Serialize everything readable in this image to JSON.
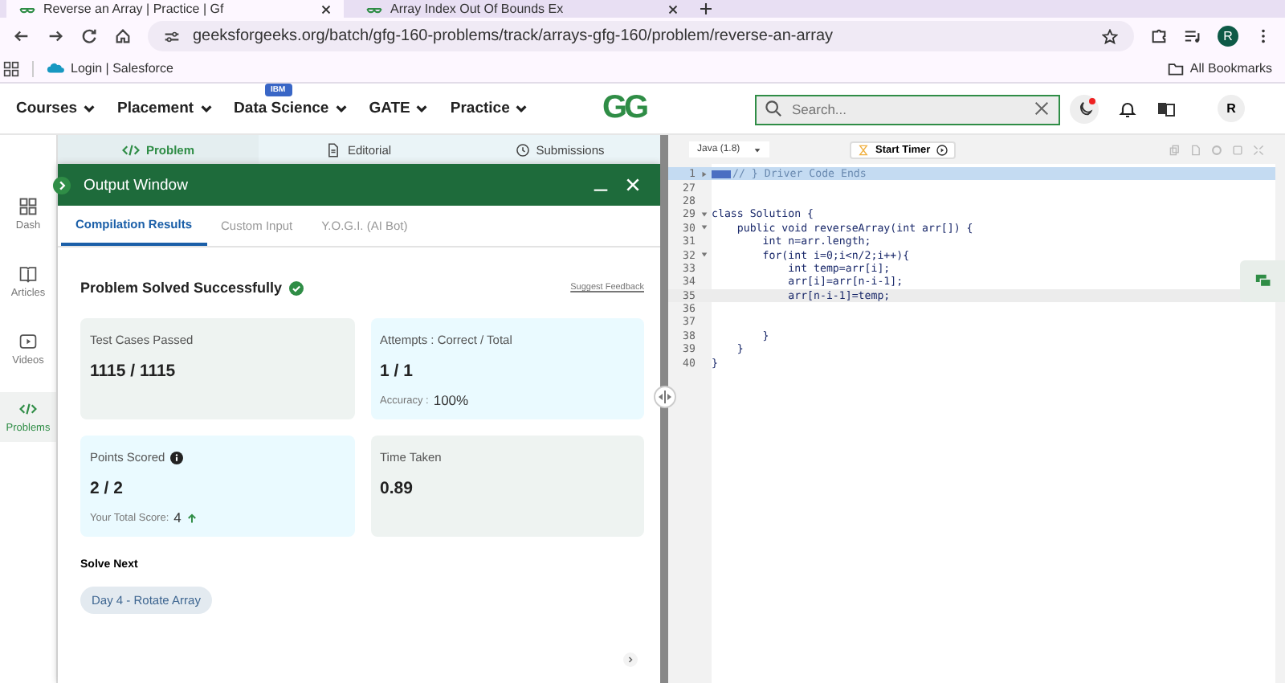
{
  "browser": {
    "tabs": [
      {
        "title": "Reverse an Array | Practice | Gf",
        "selected": true
      },
      {
        "title": "Array Index Out Of Bounds Ex",
        "selected": false
      }
    ],
    "url": "geeksforgeeks.org/batch/gfg-160-problems/track/arrays-gfg-160/problem/reverse-an-array",
    "profile": "R",
    "bookmarks": [
      "Login | Salesforce"
    ],
    "all_bookmarks": "All Bookmarks"
  },
  "site_nav": {
    "items": [
      {
        "label": "Courses"
      },
      {
        "label": "Placement"
      },
      {
        "label": "Data Science",
        "badge": "IBM"
      },
      {
        "label": "GATE"
      },
      {
        "label": "Practice"
      }
    ],
    "logo": "GG",
    "search": {
      "placeholder": "Search..."
    },
    "avatar": "R"
  },
  "sidebar": [
    {
      "label": "Dash",
      "kind": "grid",
      "selected": false
    },
    {
      "label": "Articles",
      "kind": "book",
      "selected": false
    },
    {
      "label": "Videos",
      "kind": "play",
      "selected": false
    },
    {
      "label": "Problems",
      "kind": "code",
      "selected": true
    }
  ],
  "problem_tabs": [
    {
      "label": "Problem",
      "kind": "code",
      "selected": true
    },
    {
      "label": "Editorial",
      "kind": "doc",
      "selected": false
    },
    {
      "label": "Submissions",
      "kind": "clock",
      "selected": false
    }
  ],
  "output_window": {
    "title": "Output Window",
    "tabs": [
      {
        "label": "Compilation Results",
        "selected": true
      },
      {
        "label": "Custom Input",
        "selected": false
      },
      {
        "label": "Y.O.G.I. (AI Bot)",
        "selected": false
      }
    ],
    "status": "Problem Solved Successfully",
    "feedback": "Suggest Feedback",
    "cards": [
      {
        "label": "Test Cases Passed",
        "value": "1115 / 1115",
        "color": "#eef3f1",
        "info": false
      },
      {
        "label": "Attempts : Correct / Total",
        "value": "1 / 1",
        "color": "#eafaff",
        "info": false,
        "sub_label": "Accuracy :",
        "sub_value": "100%",
        "rising": false
      },
      {
        "label": "Points Scored",
        "value": "2 / 2",
        "color": "#eafaff",
        "info": true,
        "sub_label": "Your Total Score:",
        "sub_value": "4",
        "rising": true
      },
      {
        "label": "Time Taken",
        "value": "0.89",
        "color": "#eef3f1",
        "info": false
      }
    ],
    "solve_next": {
      "title": "Solve Next",
      "items": [
        "Day 4 - Rotate Array"
      ]
    }
  },
  "editor": {
    "language": "Java (1.8)",
    "timer": "Start Timer",
    "lines": [
      {
        "number": "1",
        "foldable": true,
        "folded": true,
        "code": "// } Driver Code Ends",
        "kind": "comment",
        "highlighted": true,
        "current": false
      },
      {
        "number": "27",
        "foldable": false,
        "folded": false,
        "highlighted": false,
        "current": false
      },
      {
        "number": "28",
        "foldable": false,
        "folded": false,
        "highlighted": false,
        "current": false
      },
      {
        "number": "29",
        "foldable": true,
        "folded": false,
        "code": "class Solution {",
        "kind": "code",
        "highlighted": false,
        "current": false
      },
      {
        "number": "30",
        "foldable": true,
        "folded": false,
        "code": "    public void reverseArray(int arr[]) {",
        "kind": "code",
        "highlighted": false,
        "current": false
      },
      {
        "number": "31",
        "foldable": false,
        "folded": false,
        "code": "        int n=arr.length;",
        "kind": "code",
        "highlighted": false,
        "current": false
      },
      {
        "number": "32",
        "foldable": true,
        "folded": false,
        "code": "        for(int i=0;i<n/2;i++){",
        "kind": "code",
        "highlighted": false,
        "current": false
      },
      {
        "number": "33",
        "foldable": false,
        "folded": false,
        "code": "            int temp=arr[i];",
        "kind": "code",
        "highlighted": false,
        "current": false
      },
      {
        "number": "34",
        "foldable": false,
        "folded": false,
        "code": "            arr[i]=arr[n-i-1];",
        "kind": "code",
        "highlighted": false,
        "current": false
      },
      {
        "number": "35",
        "foldable": false,
        "folded": false,
        "code": "            arr[n-i-1]=temp;",
        "kind": "code",
        "highlighted": false,
        "current": true
      },
      {
        "number": "36",
        "foldable": false,
        "folded": false,
        "highlighted": false,
        "current": false
      },
      {
        "number": "37",
        "foldable": false,
        "folded": false,
        "highlighted": false,
        "current": false
      },
      {
        "number": "38",
        "foldable": false,
        "folded": false,
        "code": "        }",
        "kind": "code",
        "highlighted": false,
        "current": false
      },
      {
        "number": "39",
        "foldable": false,
        "folded": false,
        "code": "    }",
        "kind": "code",
        "highlighted": false,
        "current": false
      },
      {
        "number": "40",
        "foldable": false,
        "folded": false,
        "code": "}",
        "kind": "code",
        "highlighted": false,
        "current": false
      }
    ]
  }
}
